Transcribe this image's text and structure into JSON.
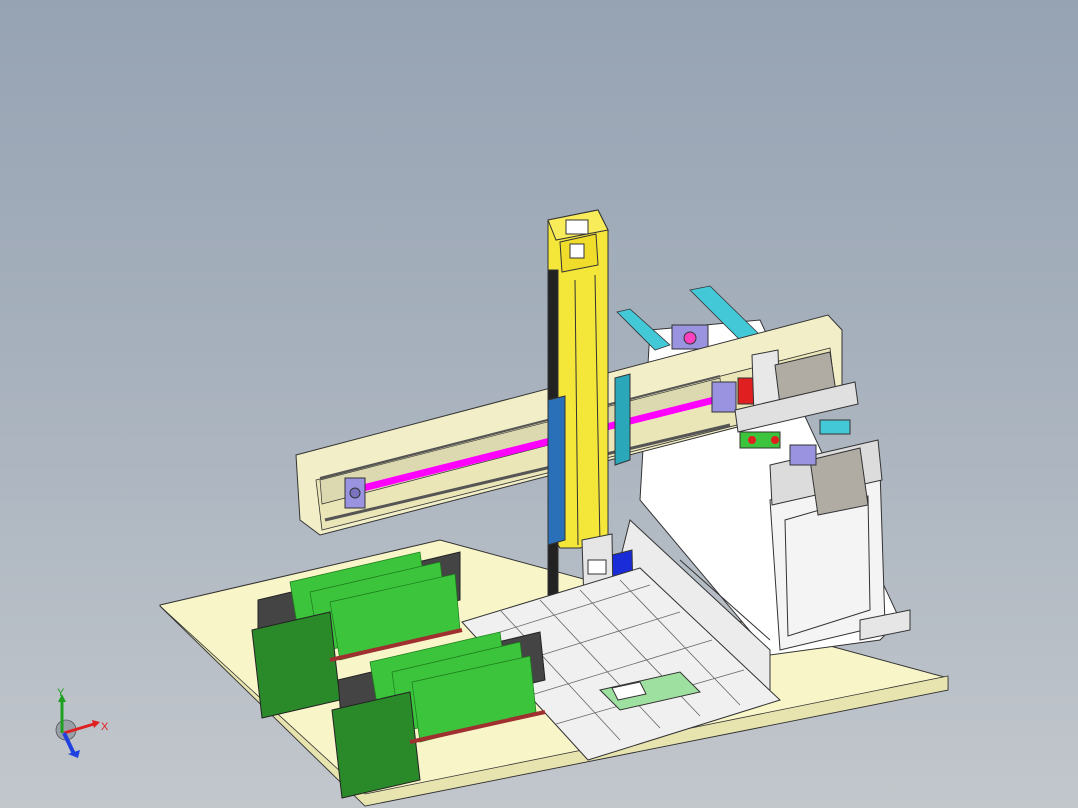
{
  "triad": {
    "x_label": "X",
    "y_label": "Y",
    "x_color": "#e02020",
    "y_color": "#20a020",
    "z_color": "#2040e0"
  },
  "colors": {
    "background_top": "#96a3b3",
    "baseplate": "#f8f5c8",
    "gantry_beam": "#f2efc8",
    "vertical_axis": "#f5e63a",
    "belt_magenta": "#ff00ff",
    "pcb_green": "#3cc43c",
    "blue_carriage": "#1a2bd8",
    "teal_plate": "#2aa7b8",
    "rail_cyan": "#43c8d8",
    "bearing_lavender": "#9a94e0",
    "coupling_red": "#e02020",
    "motor_gray": "#b0aca4"
  },
  "scene": {
    "description_items": [
      "baseplate",
      "x-gantry-beam",
      "z-vertical-axis",
      "y-rail-support",
      "pcb-magazine-left",
      "pcb-magazine-right",
      "tray"
    ]
  }
}
